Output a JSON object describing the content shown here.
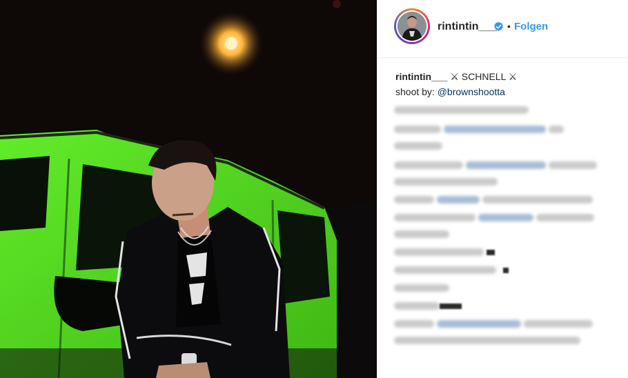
{
  "post": {
    "photo_alt": "",
    "account": {
      "username": "rintintin___",
      "verified": true,
      "separator": "•",
      "follow_label": "Folgen",
      "avatar_icon": "profile-avatar"
    },
    "caption": {
      "username": "rintintin___",
      "text": " ⚔ SCHNELL ⚔",
      "credit_prefix": "shoot by: ",
      "credit_mention": "@brownshootta"
    },
    "comments_blurred": true
  },
  "colors": {
    "accent": "#3897f0",
    "text": "#262626",
    "mention": "#003569",
    "car_green": "#56e01e"
  }
}
